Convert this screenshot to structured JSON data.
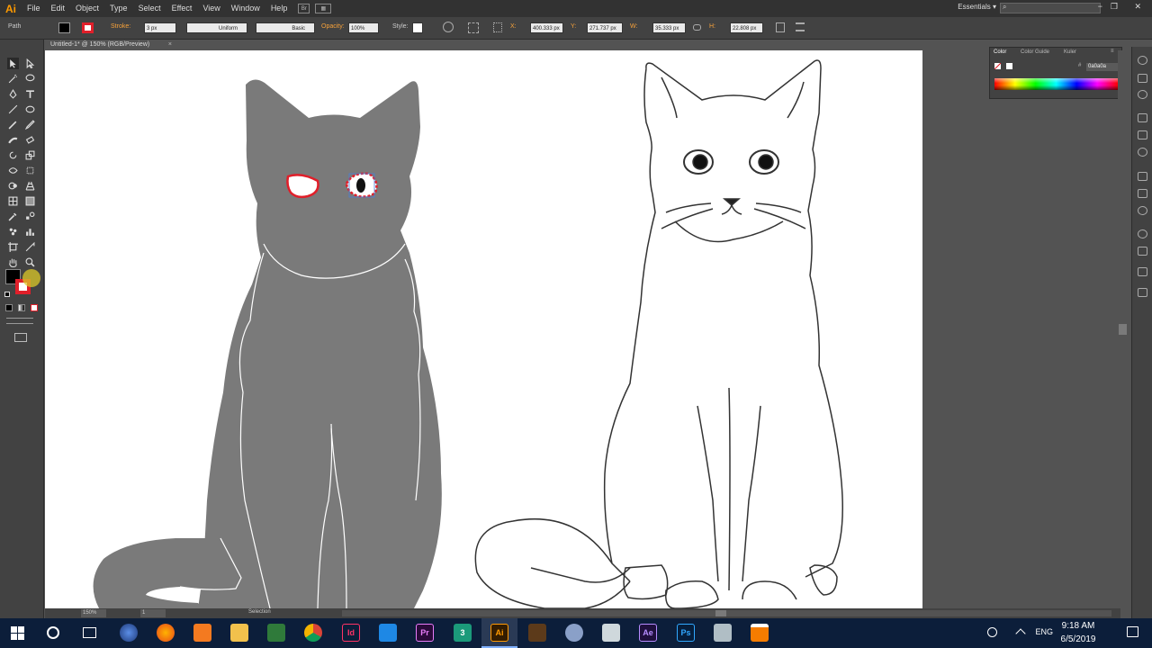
{
  "app": {
    "logo": "Ai"
  },
  "menus": [
    "File",
    "Edit",
    "Object",
    "Type",
    "Select",
    "Effect",
    "View",
    "Window",
    "Help"
  ],
  "menu_extras": [
    "Br",
    "▦"
  ],
  "workspace": "Essentials",
  "search_placeholder": "",
  "window_buttons": [
    "−",
    "❐",
    "✕"
  ],
  "control_bar": {
    "selection_type": "Path",
    "stroke_label": "Stroke:",
    "stroke_weight": "3 px",
    "profile": "Uniform",
    "brush": "Basic",
    "opacity_label": "Opacity:",
    "opacity": "100%",
    "style_label": "Style:",
    "x_label": "X:",
    "x_value": "400.333 px",
    "y_label": "Y:",
    "y_value": "271.737 px",
    "w_label": "W:",
    "w_value": "35.333 px",
    "h_label": "H:",
    "h_value": "22.808 px"
  },
  "document_tab": {
    "title": "Untitled-1* @ 150% (RGB/Preview)",
    "close": "×"
  },
  "color_panel": {
    "tabs": [
      "Color",
      "Color Guide",
      "Kuler"
    ],
    "hex": "0a0a0a"
  },
  "status_bar": {
    "zoom": "150%",
    "artboard": "1",
    "tool": "Selection"
  },
  "taskbar": {
    "time": "9:18 AM",
    "date": "6/5/2019",
    "language": "ENG",
    "apps": [
      {
        "name": "Id",
        "color": "#49021f",
        "fg": "#ff3366"
      },
      {
        "name": "Pr",
        "color": "#2a0a3a",
        "fg": "#e77cf8"
      },
      {
        "name": "3",
        "color": "#1b9a7a",
        "fg": "#ffffff"
      },
      {
        "name": "Ai",
        "color": "#331c00",
        "fg": "#ff9a00"
      },
      {
        "name": "Ae",
        "color": "#1f0f3d",
        "fg": "#b68cff"
      },
      {
        "name": "Ps",
        "color": "#061e3c",
        "fg": "#31a8ff"
      }
    ]
  },
  "colors": {
    "accent_red": "#e01f2a",
    "silhouette": "#7a7a7a",
    "canvas": "#ffffff"
  }
}
